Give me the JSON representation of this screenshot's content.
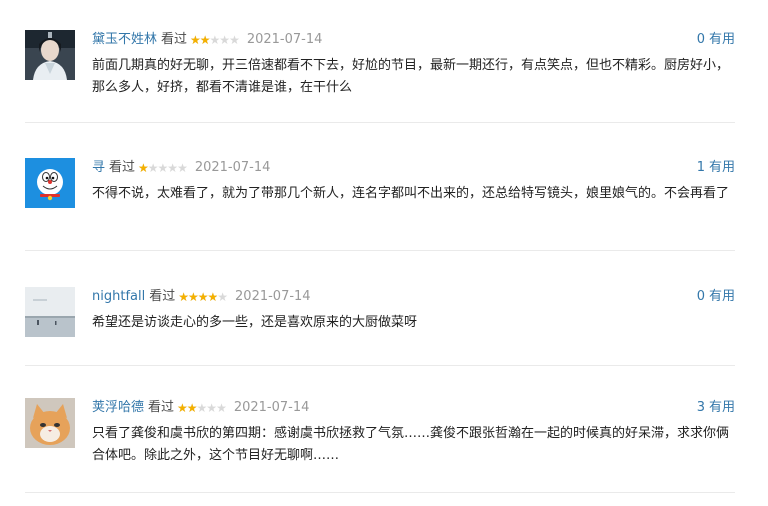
{
  "reviews": [
    {
      "user": "黛玉不姓林",
      "status": "看过",
      "rating": 2,
      "date": "2021-07-14",
      "useful_count": "0",
      "useful_label": "有用",
      "content": "前面几期真的好无聊，开三倍速都看不下去，好尬的节目，最新一期还行，有点笑点，但也不精彩。厨房好小，那么多人，好挤，都看不清谁是谁，在干什么",
      "avatar_icon": "portrait-avatar"
    },
    {
      "user": "寻",
      "status": "看过",
      "rating": 1,
      "date": "2021-07-14",
      "useful_count": "1",
      "useful_label": "有用",
      "content": "不得不说，太难看了，就为了带那几个新人，连名字都叫不出来的，还总给特写镜头，娘里娘气的。不会再看了",
      "avatar_icon": "cartoon-cat-avatar"
    },
    {
      "user": "nightfall",
      "status": "看过",
      "rating": 4,
      "date": "2021-07-14",
      "useful_count": "0",
      "useful_label": "有用",
      "content": "希望还是访谈走心的多一些，还是喜欢原来的大厨做菜呀",
      "avatar_icon": "seascape-avatar"
    },
    {
      "user": "荚浮哈德",
      "status": "看过",
      "rating": 2,
      "date": "2021-07-14",
      "useful_count": "3",
      "useful_label": "有用",
      "content": "只看了龚俊和虞书欣的第四期：感谢虞书欣拯救了气氛……龚俊不跟张哲瀚在一起的时候真的好呆滞，求求你俩合体吧。除此之外，这个节目好无聊啊……",
      "avatar_icon": "orange-cat-avatar"
    }
  ]
}
